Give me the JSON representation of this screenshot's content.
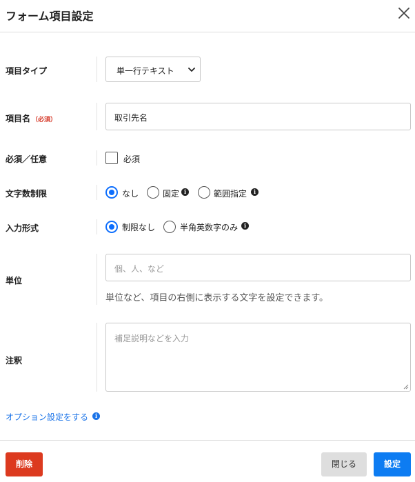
{
  "modal": {
    "title": "フォーム項目設定",
    "close_icon": "close-icon"
  },
  "fields": {
    "item_type": {
      "label": "項目タイプ",
      "value": "単一行テキスト"
    },
    "item_name": {
      "label": "項目名",
      "required_badge": "（必須）",
      "value": "取引先名"
    },
    "required": {
      "label": "必須／任意",
      "checkbox_label": "必須",
      "checked": false
    },
    "char_limit": {
      "label": "文字数制限",
      "options": [
        "なし",
        "固定",
        "範囲指定"
      ],
      "selected": "なし"
    },
    "input_format": {
      "label": "入力形式",
      "options": [
        "制限なし",
        "半角英数字のみ"
      ],
      "selected": "制限なし"
    },
    "unit": {
      "label": "単位",
      "placeholder": "個、人、など",
      "help": "単位など、項目の右側に表示する文字を設定できます。"
    },
    "note": {
      "label": "注釈",
      "placeholder": "補足説明などを入力"
    }
  },
  "option_link": "オプション設定をする",
  "footer": {
    "delete_label": "削除",
    "close_label": "閉じる",
    "save_label": "設定"
  },
  "colors": {
    "accent": "#0d6efd",
    "danger": "#dc3a1f",
    "link": "#1a73e8",
    "required_badge": "#d63a2a"
  }
}
